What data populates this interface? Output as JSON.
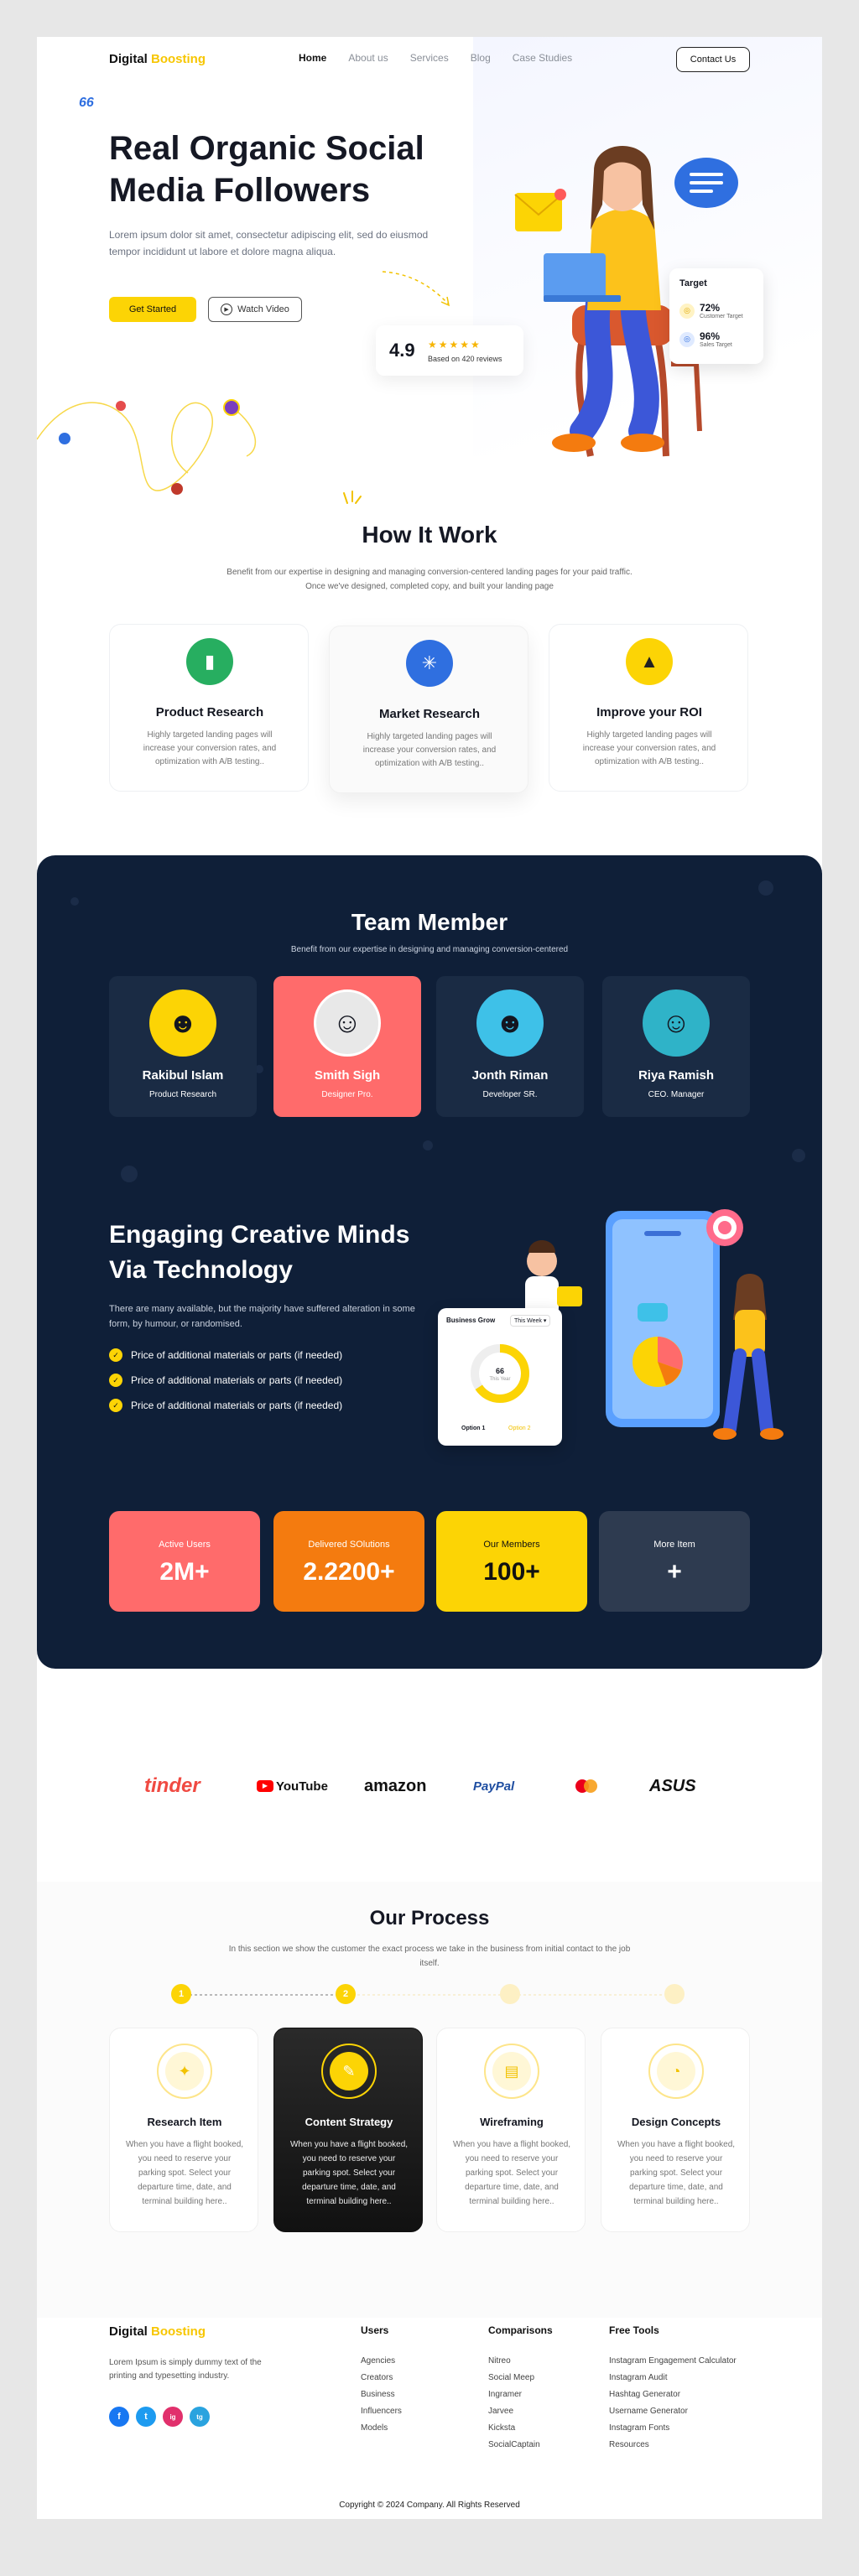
{
  "brand": {
    "name_part1": "Digital",
    "name_part2": "Boosting"
  },
  "nav": {
    "items": [
      "Home",
      "About us",
      "Services",
      "Blog",
      "Case Studies"
    ],
    "contact": "Contact Us"
  },
  "hero": {
    "quote_mark": "66",
    "title": "Real Organic Social Media Followers",
    "text": "Lorem ipsum dolor sit amet, consectetur adipiscing elit, sed do eiusmod tempor incididunt ut labore et dolore magna aliqua.",
    "cta_primary": "Get Started",
    "cta_secondary": "Watch Video",
    "rating_value": "4.9",
    "rating_stars": "★★★★★",
    "rating_text": "Based on 420 reviews",
    "target": {
      "title": "Target",
      "stat1_value": "72%",
      "stat1_label": "Customer Target",
      "stat2_value": "96%",
      "stat2_label": "Sales Target"
    }
  },
  "how": {
    "title": "How It Work",
    "subtitle": "Benefit from our expertise in designing and managing conversion-centered landing pages for your paid traffic. Once we've designed, completed copy, and built your landing page",
    "cards": [
      {
        "title": "Product Research",
        "text": "Highly targeted landing pages will increase your conversion rates, and optimization with A/B testing..",
        "icon": "chart-icon",
        "color": "#27ae60"
      },
      {
        "title": "Market Research",
        "text": "Highly targeted landing pages will increase your conversion rates, and optimization with A/B testing..",
        "icon": "cursor-click-icon",
        "color": "#2f6fe0"
      },
      {
        "title": "Improve your ROI",
        "text": "Highly targeted landing pages will increase your conversion rates, and optimization with A/B testing..",
        "icon": "growth-icon",
        "color": "#fcd405"
      }
    ]
  },
  "team": {
    "title": "Team Member",
    "subtitle": "Benefit from our expertise in designing and managing conversion-centered",
    "members": [
      {
        "name": "Rakibul Islam",
        "role": "Product Research"
      },
      {
        "name": "Smith Sigh",
        "role": "Designer Pro."
      },
      {
        "name": "Jonth Riman",
        "role": "Developer SR."
      },
      {
        "name": "Riya Ramish",
        "role": "CEO. Manager"
      }
    ]
  },
  "engaging": {
    "title": "Engaging Creative Minds Via Technology",
    "text": "There are many available, but the majority have suffered alteration in some form, by humour, or randomised.",
    "points": [
      "Price of additional materials or parts (if needed)",
      "Price of additional materials or parts (if needed)",
      "Price of additional materials or parts (if needed)"
    ],
    "widget": {
      "title": "Business Grow",
      "period": "This Week",
      "center_value": "66",
      "center_label": "This Year",
      "option1": "Option 1",
      "option2": "Option 2"
    }
  },
  "stats": [
    {
      "label": "Active Users",
      "value": "2M+",
      "bg": "#ff6b6b",
      "fg": "#ffffff"
    },
    {
      "label": "Delivered SOlutions",
      "value": "2.2200+",
      "bg": "#f47b0f",
      "fg": "#ffffff"
    },
    {
      "label": "Our Members",
      "value": "100+",
      "bg": "#fcd405",
      "fg": "#111111"
    },
    {
      "label": "More Item",
      "value": "+",
      "bg": "#2e3b50",
      "fg": "#ffffff"
    }
  ],
  "brands": [
    "tinder",
    "YouTube",
    "amazon",
    "PayPal",
    "mastercard",
    "ASUS"
  ],
  "process": {
    "title": "Our Process",
    "subtitle": "In this section we show the customer the exact process we take in the business from initial contact to the job itself.",
    "steps": [
      "1",
      "2",
      "",
      ""
    ],
    "cards": [
      {
        "title": "Research Item",
        "text": "When you have a flight booked, you need to reserve your parking spot. Select your departure time, date, and terminal building here..",
        "icon": "lightbulb-icon"
      },
      {
        "title": "Content Strategy",
        "text": "When you have a flight booked, you need to reserve your parking spot. Select your departure time, date, and terminal building here..",
        "icon": "strategy-icon"
      },
      {
        "title": "Wireframing",
        "text": "When you have a flight booked, you need to reserve your parking spot. Select your departure time, date, and terminal building here..",
        "icon": "wireframe-icon"
      },
      {
        "title": "Design Concepts",
        "text": "When you have a flight booked, you need to reserve your parking spot. Select your departure time, date, and terminal building here..",
        "icon": "pie-chart-icon"
      }
    ]
  },
  "footer": {
    "text": "Lorem Ipsum is simply dummy text of the printing and typesetting industry.",
    "social": [
      "f",
      "t",
      "ig",
      "tg"
    ],
    "columns": [
      {
        "title": "Users",
        "links": [
          "Agencies",
          "Creators",
          "Business",
          "Influencers",
          "Models"
        ]
      },
      {
        "title": "Comparisons",
        "links": [
          "Nitreo",
          "Social Meep",
          "Ingramer",
          "Jarvee",
          "Kicksta",
          "SocialCaptain"
        ]
      },
      {
        "title": "Free Tools",
        "links": [
          "Instagram Engagement Calculator",
          "Instagram Audit",
          "Hashtag Generator",
          "Username Generator",
          "Instagram Fonts",
          "Resources"
        ]
      }
    ],
    "copyright": "Copyright © 2024 Company. All Rights Reserved"
  },
  "colors": {
    "accent": "#fcd405",
    "dark": "#0f1f38",
    "coral": "#ff6b6b"
  }
}
